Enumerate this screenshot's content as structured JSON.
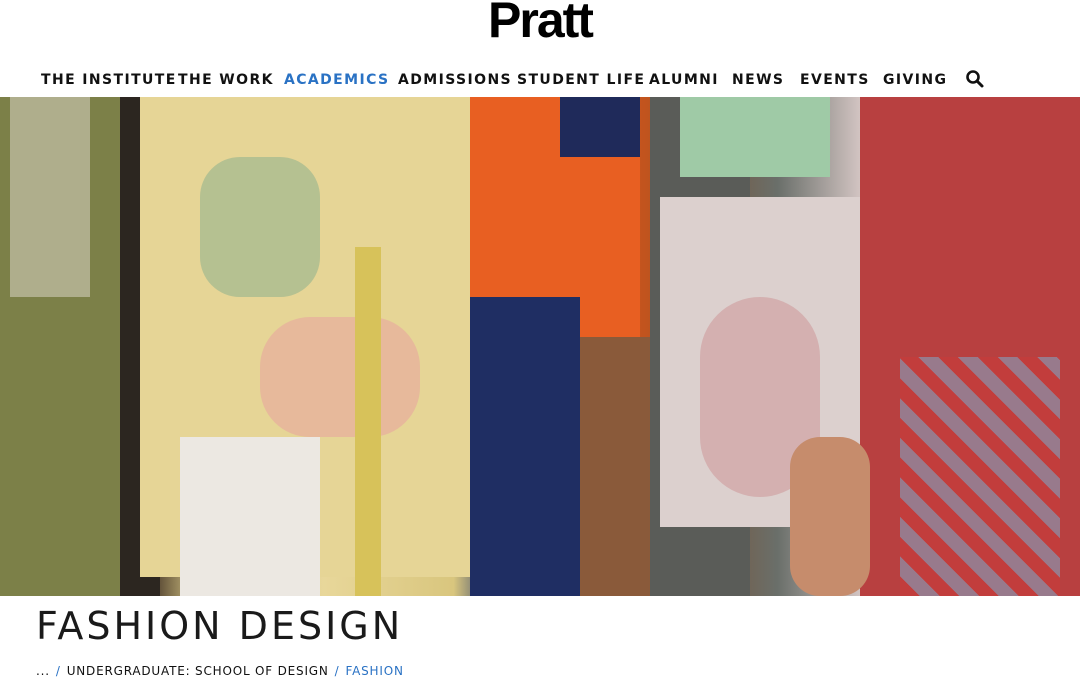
{
  "header": {
    "logo_text": "Pratt"
  },
  "nav": {
    "items": [
      {
        "label": "THE INSTITUTE",
        "active": false
      },
      {
        "label": "THE WORK",
        "active": false
      },
      {
        "label": "ACADEMICS",
        "active": true
      },
      {
        "label": "ADMISSIONS",
        "active": false
      },
      {
        "label": "STUDENT LIFE",
        "active": false
      },
      {
        "label": "ALUMNI",
        "active": false
      },
      {
        "label": "NEWS",
        "active": false
      },
      {
        "label": "EVENTS",
        "active": false
      },
      {
        "label": "GIVING",
        "active": false
      }
    ],
    "search_icon": "search-icon"
  },
  "page": {
    "title": "FASHION DESIGN"
  },
  "breadcrumb": {
    "ellipsis": "...",
    "separator": "/",
    "parent": "UNDERGRADUATE: SCHOOL OF DESIGN",
    "current": "FASHION"
  },
  "colors": {
    "accent": "#2a72c4",
    "text": "#111111",
    "background": "#ffffff"
  }
}
